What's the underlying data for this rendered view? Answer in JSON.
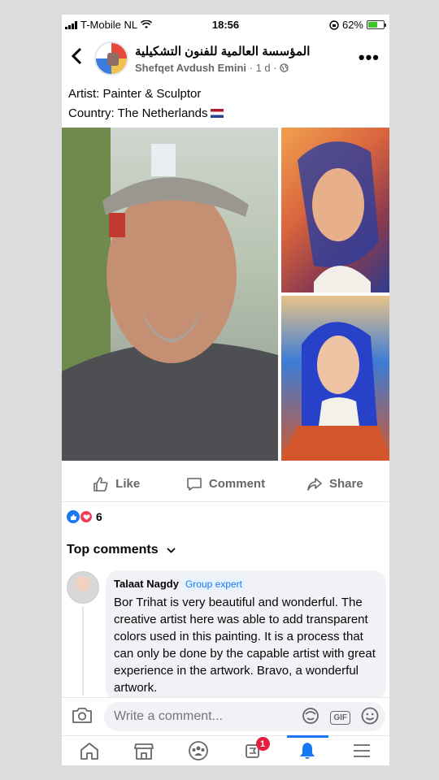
{
  "status_bar": {
    "carrier": "T-Mobile NL",
    "time": "18:56",
    "battery": "62%",
    "battery_level": 0.62
  },
  "header": {
    "group_name": "المؤسسة العالمية للفنون التشكيلية",
    "author": "Shefqet Avdush Emini",
    "meta": "· 1 d ·"
  },
  "post": {
    "line1": "Artist: Painter & Sculptor",
    "line2": "Country: The Netherlands"
  },
  "actions": {
    "like": "Like",
    "comment": "Comment",
    "share": "Share"
  },
  "reactions": {
    "count": "6"
  },
  "comments": {
    "heading": "Top comments",
    "first": {
      "name": "Talaat Nagdy",
      "badge": "Group expert",
      "text": "Bor Trihat is very beautiful and wonderful. The creative artist here was able to add transparent colors used in this painting. It is a process that can only be done by the capable artist with great experience in the artwork. Bravo, a wonderful artwork."
    }
  },
  "composer": {
    "placeholder": "Write a comment...",
    "gif_label": "GIF"
  },
  "bottom_nav": {
    "notification_badge": "1"
  },
  "colors": {
    "accent": "#1877f2",
    "badge_red": "#e41e3f",
    "secondary_text": "#65676b"
  }
}
